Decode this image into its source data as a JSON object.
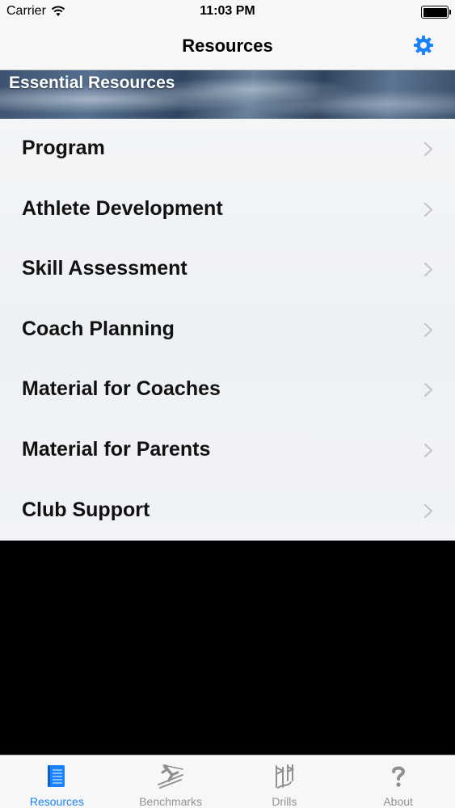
{
  "status_bar": {
    "carrier": "Carrier",
    "time": "11:03 PM",
    "battery_level": 1.0
  },
  "nav": {
    "title": "Resources",
    "settings_icon": "gear-icon",
    "accent_color": "#1a82fb"
  },
  "section": {
    "title": "Essential Resources"
  },
  "list": {
    "items": [
      {
        "label": "Program"
      },
      {
        "label": "Athlete Development"
      },
      {
        "label": "Skill Assessment"
      },
      {
        "label": "Coach Planning"
      },
      {
        "label": "Material for Coaches"
      },
      {
        "label": "Material for Parents"
      },
      {
        "label": "Club Support"
      }
    ]
  },
  "tabs": {
    "items": [
      {
        "label": "Resources",
        "icon": "book-icon",
        "active": true
      },
      {
        "label": "Benchmarks",
        "icon": "skier-icon",
        "active": false
      },
      {
        "label": "Drills",
        "icon": "slalom-gates-icon",
        "active": false
      },
      {
        "label": "About",
        "icon": "question-mark-icon",
        "active": false
      }
    ]
  }
}
